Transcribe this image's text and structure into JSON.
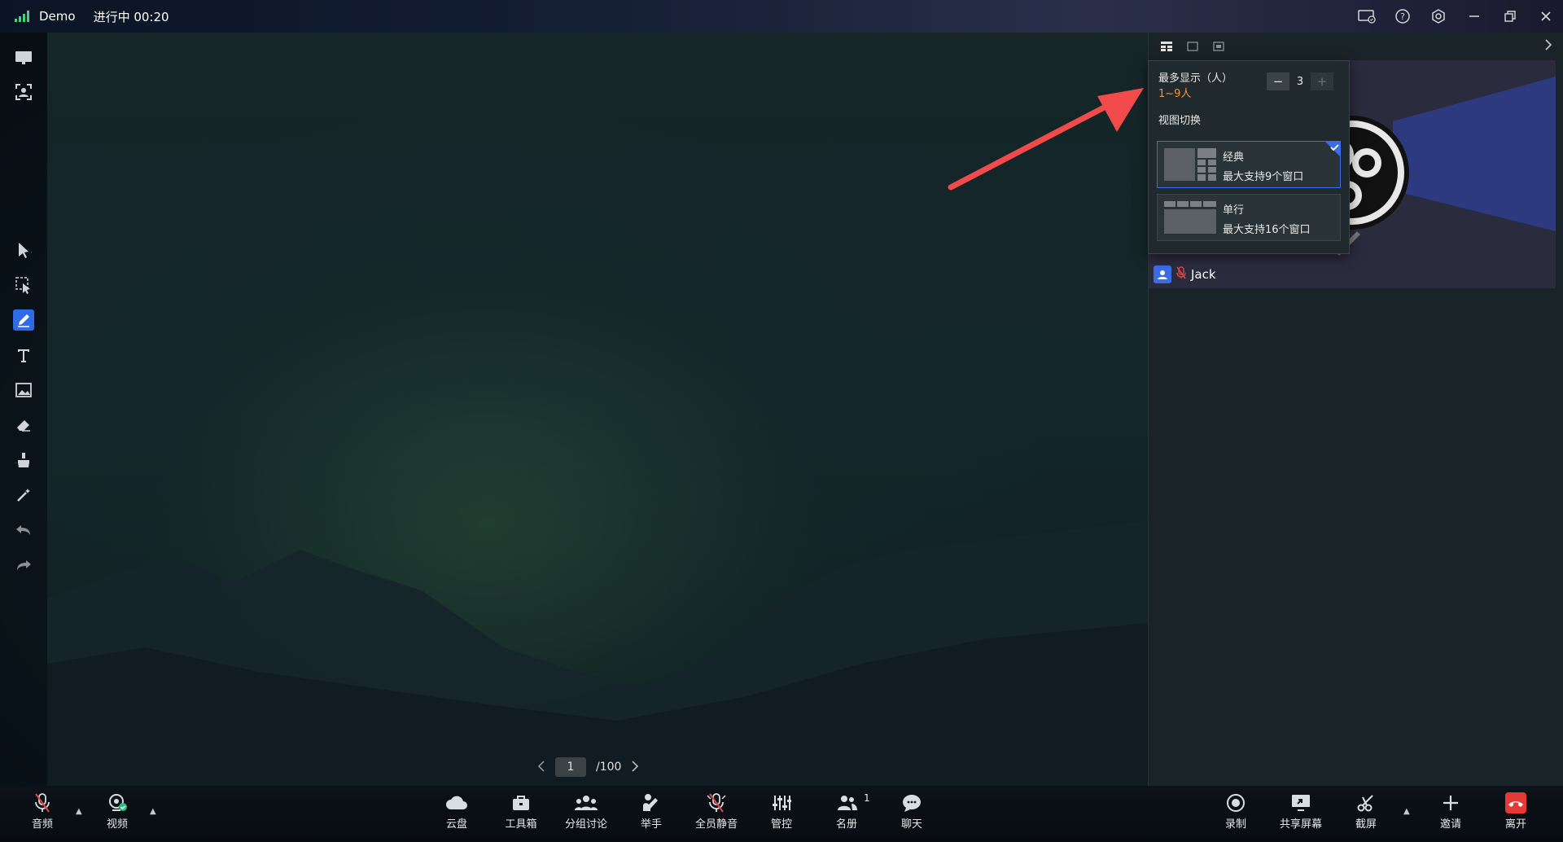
{
  "titlebar": {
    "app_name": "Demo",
    "status": "进行中 00:20"
  },
  "right_panel": {
    "participant_name": "Jack"
  },
  "popup": {
    "max_display_label": "最多显示（人）",
    "range_label": "1~9人",
    "max_display_value": "3",
    "view_switch_label": "视图切换",
    "layouts": [
      {
        "name": "经典",
        "desc": "最大支持9个窗口",
        "selected": true
      },
      {
        "name": "单行",
        "desc": "最大支持16个窗口",
        "selected": false
      }
    ]
  },
  "pager": {
    "current_page": "1",
    "total_label": "/100"
  },
  "bottombar": {
    "audio": "音频",
    "video": "视频",
    "cloud": "云盘",
    "toolbox": "工具箱",
    "breakout": "分组讨论",
    "raise_hand": "举手",
    "mute_all": "全员静音",
    "control": "管控",
    "roster": "名册",
    "roster_count": "1",
    "chat": "聊天",
    "record": "录制",
    "share_screen": "共享屏幕",
    "screenshot": "截屏",
    "invite": "邀请",
    "leave": "离开"
  },
  "colors": {
    "accent": "#3b6ce8",
    "range_orange": "#f0953a",
    "leave_red": "#e53935",
    "arrow_red": "#f04a4a",
    "signal_green": "#3ed67a"
  }
}
